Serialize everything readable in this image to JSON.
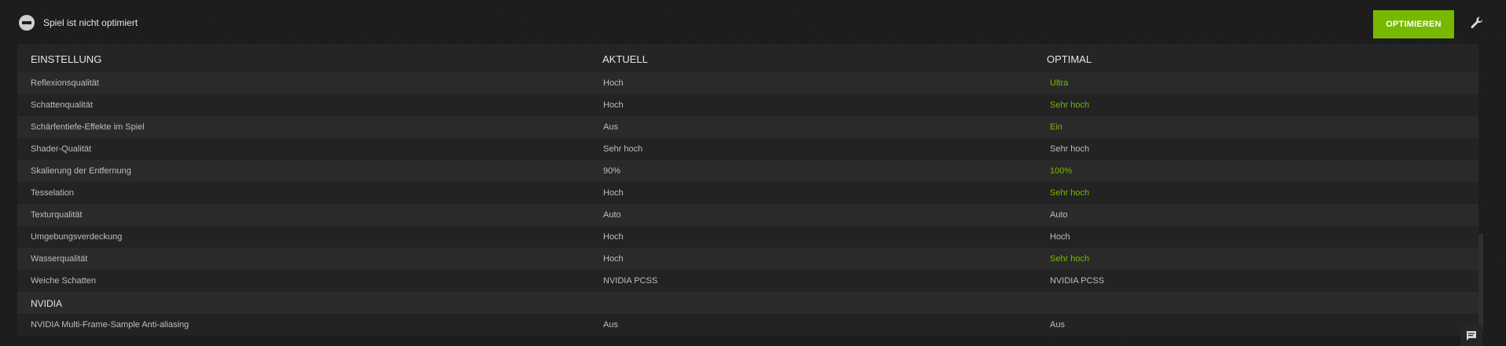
{
  "status": {
    "text": "Spiel ist nicht optimiert",
    "icon": "minus-circle-icon"
  },
  "toolbar": {
    "optimize_label": "OPTIMIEREN",
    "settings_icon": "wrench-icon",
    "accent_color": "#76b900"
  },
  "table": {
    "headers": {
      "setting": "EINSTELLUNG",
      "current": "AKTUELL",
      "optimal": "OPTIMAL"
    },
    "rows": [
      {
        "setting": "Reflexionsqualität",
        "current": "Hoch",
        "optimal": "Ultra",
        "changed": true
      },
      {
        "setting": "Schattenqualität",
        "current": "Hoch",
        "optimal": "Sehr hoch",
        "changed": true
      },
      {
        "setting": "Schärfentiefe-Effekte im Spiel",
        "current": "Aus",
        "optimal": "Ein",
        "changed": true
      },
      {
        "setting": "Shader-Qualität",
        "current": "Sehr hoch",
        "optimal": "Sehr hoch",
        "changed": false
      },
      {
        "setting": "Skalierung der Entfernung",
        "current": "90%",
        "optimal": "100%",
        "changed": true
      },
      {
        "setting": "Tesselation",
        "current": "Hoch",
        "optimal": "Sehr hoch",
        "changed": true
      },
      {
        "setting": "Texturqualität",
        "current": "Auto",
        "optimal": "Auto",
        "changed": false
      },
      {
        "setting": "Umgebungsverdeckung",
        "current": "Hoch",
        "optimal": "Hoch",
        "changed": false
      },
      {
        "setting": "Wasserqualität",
        "current": "Hoch",
        "optimal": "Sehr hoch",
        "changed": true
      },
      {
        "setting": "Weiche Schatten",
        "current": "NVIDIA PCSS",
        "optimal": "NVIDIA PCSS",
        "changed": false
      }
    ],
    "section": "NVIDIA",
    "section_rows": [
      {
        "setting": "NVIDIA Multi-Frame-Sample Anti-aliasing",
        "current": "Aus",
        "optimal": "Aus",
        "changed": false
      }
    ]
  },
  "chat": {
    "icon": "chat-icon"
  }
}
